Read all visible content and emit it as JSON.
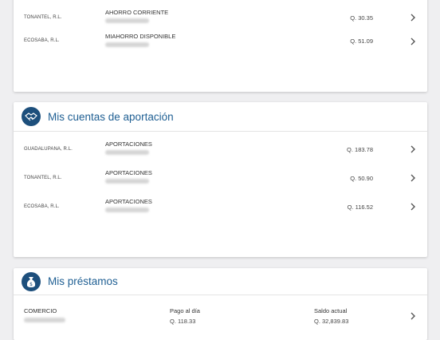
{
  "savings": {
    "rows": [
      {
        "coop": "TONANTEL, R.L.",
        "product": "AHORRO CORRIENTE",
        "amount": "Q. 30.35"
      },
      {
        "coop": "ECOSABA, R.L.",
        "product": "MIAHORRO DISPONIBLE",
        "amount": "Q. 51.09"
      }
    ]
  },
  "contributions": {
    "title": "Mis cuentas de aportación",
    "icon": "handshake-icon",
    "rows": [
      {
        "coop": "GUADALUPANA, R.L.",
        "product": "APORTACIONES",
        "amount": "Q. 183.78"
      },
      {
        "coop": "TONANTEL, R.L.",
        "product": "APORTACIONES",
        "amount": "Q. 50.90"
      },
      {
        "coop": "ECOSABA, R.L.",
        "product": "APORTACIONES",
        "amount": "Q. 116.52"
      }
    ]
  },
  "loans": {
    "title": "Mis préstamos",
    "icon": "money-bag-icon",
    "rows": [
      {
        "type": "COMERCIO",
        "payment_label": "Pago al día",
        "payment_value": "Q. 118.33",
        "balance_label": "Saldo actual",
        "balance_value": "Q. 32,839.83"
      }
    ]
  },
  "colors": {
    "accent": "#1f5f93",
    "icon_bg": "#1d4f7c",
    "background": "#efeff1"
  }
}
